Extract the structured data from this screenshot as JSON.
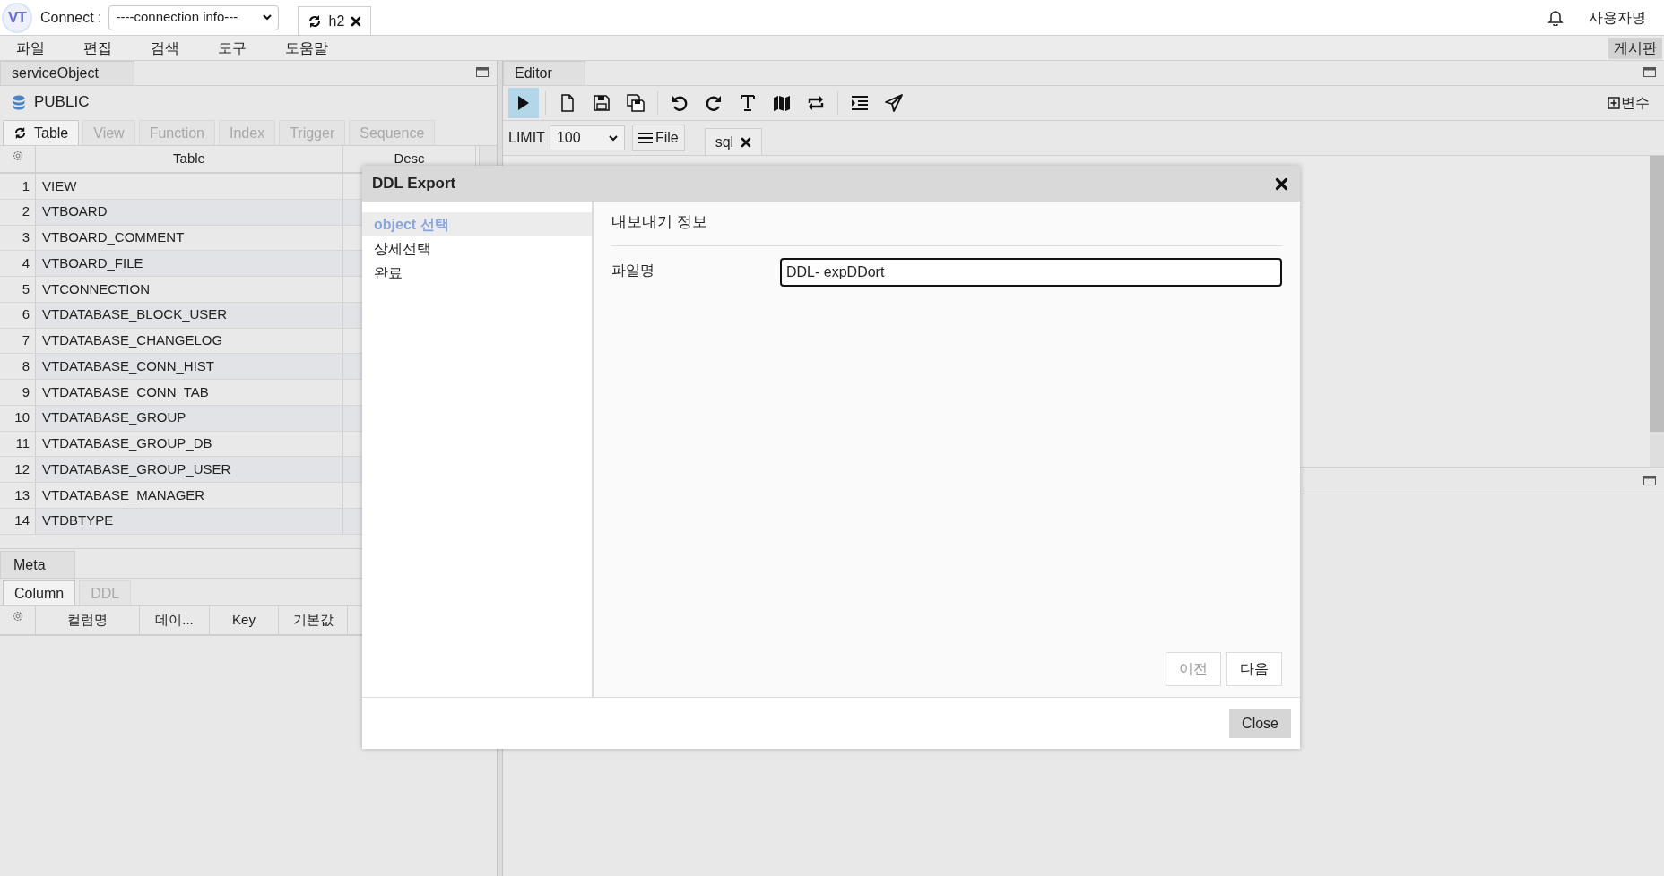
{
  "topbar": {
    "logo": "VT",
    "connect_label": "Connect :",
    "connection_select": "----connection info---",
    "session_tab": {
      "label": "h2"
    },
    "user": "사용자명"
  },
  "menu": [
    "파일",
    "편집",
    "검색",
    "도구",
    "도움말"
  ],
  "board_button": "게시판",
  "object_panel": {
    "title": "serviceObject",
    "schema": "PUBLIC",
    "tabs": [
      {
        "label": "Table",
        "selected": true
      },
      {
        "label": "View",
        "selected": false
      },
      {
        "label": "Function",
        "selected": false
      },
      {
        "label": "Index",
        "selected": false
      },
      {
        "label": "Trigger",
        "selected": false
      },
      {
        "label": "Sequence",
        "selected": false
      }
    ],
    "table": {
      "columns": [
        "Table",
        "Desc"
      ],
      "rows": [
        {
          "n": "1",
          "name": "VIEW"
        },
        {
          "n": "2",
          "name": "VTBOARD"
        },
        {
          "n": "3",
          "name": "VTBOARD_COMMENT"
        },
        {
          "n": "4",
          "name": "VTBOARD_FILE"
        },
        {
          "n": "5",
          "name": "VTCONNECTION"
        },
        {
          "n": "6",
          "name": "VTDATABASE_BLOCK_USER"
        },
        {
          "n": "7",
          "name": "VTDATABASE_CHANGELOG"
        },
        {
          "n": "8",
          "name": "VTDATABASE_CONN_HIST"
        },
        {
          "n": "9",
          "name": "VTDATABASE_CONN_TAB"
        },
        {
          "n": "10",
          "name": "VTDATABASE_GROUP"
        },
        {
          "n": "11",
          "name": "VTDATABASE_GROUP_DB"
        },
        {
          "n": "12",
          "name": "VTDATABASE_GROUP_USER"
        },
        {
          "n": "13",
          "name": "VTDATABASE_MANAGER"
        },
        {
          "n": "14",
          "name": "VTDBTYPE"
        }
      ]
    }
  },
  "meta_panel": {
    "title": "Meta",
    "tabs": [
      {
        "label": "Column",
        "selected": true
      },
      {
        "label": "DDL",
        "selected": false
      }
    ],
    "columns": [
      "컬럼명",
      "데이...",
      "Key",
      "기본값"
    ]
  },
  "editor": {
    "title": "Editor",
    "toolbar": [
      {
        "selected": true
      },
      {
        "selected": false
      },
      {
        "selected": false
      },
      {
        "selected": false
      },
      {
        "selected": false
      },
      {
        "selected": false
      },
      {
        "selected": false
      },
      {
        "selected": false
      },
      {
        "selected": false
      },
      {
        "selected": false
      },
      {
        "selected": false
      }
    ],
    "variables_button": "변수",
    "limit_label": "LIMIT",
    "limit_value": "100",
    "file_button": "File",
    "sql_tab": "sql"
  },
  "dialog": {
    "title": "DDL Export",
    "steps": [
      {
        "label": "object 선택",
        "selected": true
      },
      {
        "label": "상세선택",
        "selected": false
      },
      {
        "label": "완료",
        "selected": false
      }
    ],
    "section_title": "내보내기 정보",
    "filename_label": "파일명",
    "filename_value": "DDL- expDDort",
    "buttons": [
      {
        "label": "이전",
        "disabled": true
      },
      {
        "label": "다음",
        "disabled": false
      }
    ],
    "close_button": "Close"
  }
}
